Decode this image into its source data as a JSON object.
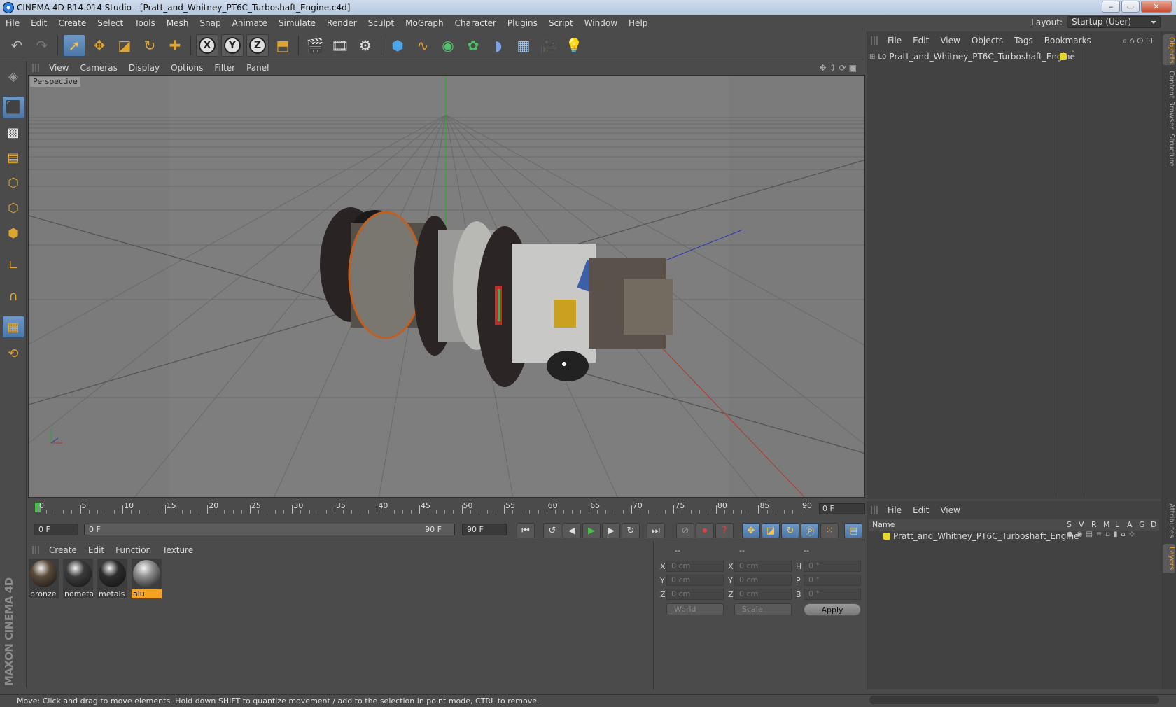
{
  "window": {
    "title": "CINEMA 4D R14.014 Studio - [Pratt_and_Whitney_PT6C_Turboshaft_Engine.c4d]",
    "min": "‒",
    "max": "▭",
    "close": "✕"
  },
  "menu": [
    "File",
    "Edit",
    "Create",
    "Select",
    "Tools",
    "Mesh",
    "Snap",
    "Animate",
    "Simulate",
    "Render",
    "Sculpt",
    "MoGraph",
    "Character",
    "Plugins",
    "Script",
    "Window",
    "Help"
  ],
  "layout": {
    "label": "Layout:",
    "value": "Startup (User)"
  },
  "toolbar": {
    "axes": [
      "X",
      "Y",
      "Z"
    ]
  },
  "viewport": {
    "menu": [
      "View",
      "Cameras",
      "Display",
      "Options",
      "Filter",
      "Panel"
    ],
    "label": "Perspective"
  },
  "timeline": {
    "ticks": [
      "0",
      "5",
      "10",
      "15",
      "20",
      "25",
      "30",
      "35",
      "40",
      "45",
      "50",
      "55",
      "60",
      "65",
      "70",
      "75",
      "80",
      "85",
      "90"
    ],
    "current": "0 F"
  },
  "transport": {
    "start": "0 F",
    "range_start": "0 F",
    "range_end": "90 F",
    "end": "90 F"
  },
  "materials": {
    "menu": [
      "Create",
      "Edit",
      "Function",
      "Texture"
    ],
    "items": [
      {
        "name": "bronze",
        "color": "#5a4a3a"
      },
      {
        "name": "nometal",
        "color": "#3b3b3b"
      },
      {
        "name": "metals",
        "color": "#2d2d2d"
      },
      {
        "name": "alu",
        "color": "#8d8d8d"
      }
    ]
  },
  "coords": {
    "headers": [
      "--",
      "--",
      "--"
    ],
    "rows": [
      {
        "a": "X",
        "v1": "0 cm",
        "b": "X",
        "v2": "0 cm",
        "c": "H",
        "v3": "0 °"
      },
      {
        "a": "Y",
        "v1": "0 cm",
        "b": "Y",
        "v2": "0 cm",
        "c": "P",
        "v3": "0 °"
      },
      {
        "a": "Z",
        "v1": "0 cm",
        "b": "Z",
        "v2": "0 cm",
        "c": "B",
        "v3": "0 °"
      }
    ],
    "mode1": "World",
    "mode2": "Scale",
    "apply": "Apply"
  },
  "objects": {
    "menu": [
      "File",
      "Edit",
      "View",
      "Objects",
      "Tags",
      "Bookmarks"
    ],
    "item": "Pratt_and_Whitney_PT6C_Turboshaft_Engine",
    "layer_color": "#e7d62a"
  },
  "right_tabs": [
    "Objects",
    "Content Browser",
    "Structure",
    "Attributes",
    "Layers"
  ],
  "layers": {
    "menu": [
      "File",
      "Edit",
      "View"
    ],
    "cols": [
      "Name",
      "S",
      "V",
      "R",
      "M",
      "L",
      "A",
      "G",
      "D"
    ],
    "item": "Pratt_and_Whitney_PT6C_Turboshaft_Engine"
  },
  "status": "Move: Click and drag to move elements. Hold down SHIFT to quantize movement / add to the selection in point mode, CTRL to remove.",
  "brand": {
    "line1": "MAXON",
    "line2": "CINEMA 4D"
  }
}
